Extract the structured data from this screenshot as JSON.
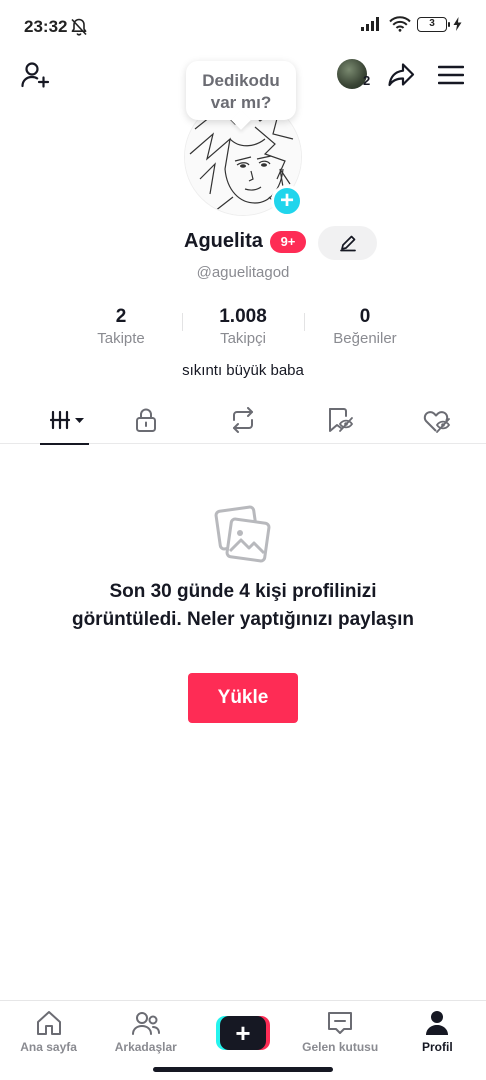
{
  "status_bar": {
    "time": "23:32",
    "battery": "3",
    "icons": [
      "bell-off-icon",
      "signal-icon",
      "wifi-icon",
      "battery-icon",
      "charging-icon"
    ]
  },
  "top_bar": {
    "viewer_count": "2",
    "icons": [
      "add-friend-icon",
      "share-icon",
      "menu-icon"
    ]
  },
  "bubble": {
    "line1": "Dedikodu",
    "line2": "var mı?"
  },
  "profile": {
    "name": "Aguelita",
    "badge": "9+",
    "username": "@aguelitagod",
    "bio": "sıkıntı büyük baba",
    "stats": [
      {
        "value": "2",
        "label": "Takipte"
      },
      {
        "value": "1.008",
        "label": "Takipçi"
      },
      {
        "value": "0",
        "label": "Beğeniler"
      }
    ]
  },
  "tabs": [
    "videos-grid-icon",
    "lock-icon",
    "repost-icon",
    "bookmark-icon",
    "liked-icon"
  ],
  "empty_state": {
    "message": "Son 30 günde 4 kişi profilinizi görüntüledi. Neler yaptığınızı paylaşın",
    "button": "Yükle"
  },
  "bottom_nav": {
    "items": [
      {
        "label": "Ana sayfa",
        "icon": "home-icon"
      },
      {
        "label": "Arkadaşlar",
        "icon": "friends-icon"
      },
      {
        "label": "",
        "icon": "plus-icon"
      },
      {
        "label": "Gelen kutusu",
        "icon": "inbox-icon"
      },
      {
        "label": "Profil",
        "icon": "profile-icon"
      }
    ],
    "active": "Profil"
  },
  "colors": {
    "accent": "#fe2c55",
    "cyan": "#25f4ee",
    "avatar_plus": "#20d5ec",
    "text": "#161823",
    "muted": "#8a8b91"
  }
}
